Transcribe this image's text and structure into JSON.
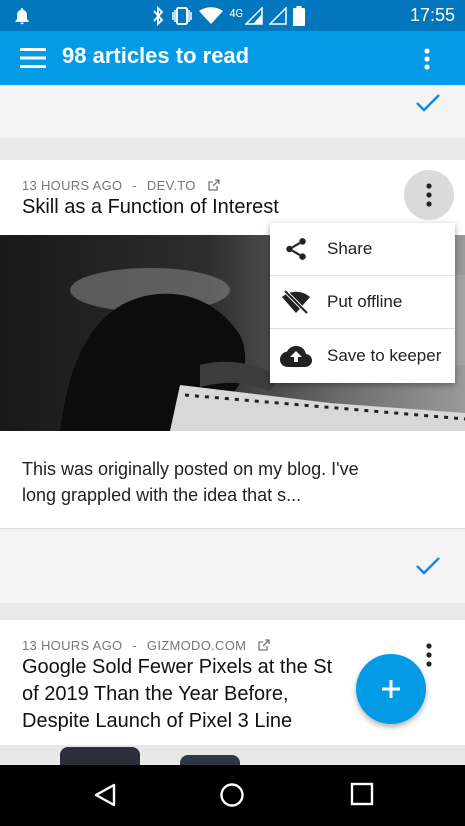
{
  "status_bar": {
    "time": "17:55",
    "network_label": "4G",
    "icons": [
      "notification-bell-icon",
      "bluetooth-icon",
      "vibrate-icon",
      "wifi-icon",
      "signal-icon",
      "signal-icon",
      "battery-icon"
    ]
  },
  "app_bar": {
    "title": "98 articles to read",
    "menu_icon": "hamburger-menu-icon",
    "more_icon": "more-vertical-icon"
  },
  "articles": [
    {
      "time_ago": "13 HOURS AGO",
      "source": "DEV.TO",
      "title": "Skill as a Function of Interest",
      "excerpt_line1": "This was originally posted on my blog. I've",
      "excerpt_line2": "long grappled with the idea that s..."
    },
    {
      "time_ago": "13 HOURS AGO",
      "source": "GIZMODO.COM",
      "title_line1": "Google Sold Fewer Pixels at the St",
      "title_line2": "of 2019 Than the Year Before,",
      "title_line3": "Despite Launch of Pixel 3 Line"
    }
  ],
  "separator": "-",
  "context_menu": {
    "items": [
      {
        "label": "Share",
        "icon": "share-icon"
      },
      {
        "label": "Put offline",
        "icon": "wifi-off-icon"
      },
      {
        "label": "Save to keeper",
        "icon": "cloud-upload-icon"
      }
    ]
  },
  "fab": {
    "icon": "plus-icon"
  },
  "colors": {
    "status_bar": "#0277bd",
    "app_bar": "#039be5",
    "accent": "#039be5",
    "check": "#1e88e5"
  }
}
